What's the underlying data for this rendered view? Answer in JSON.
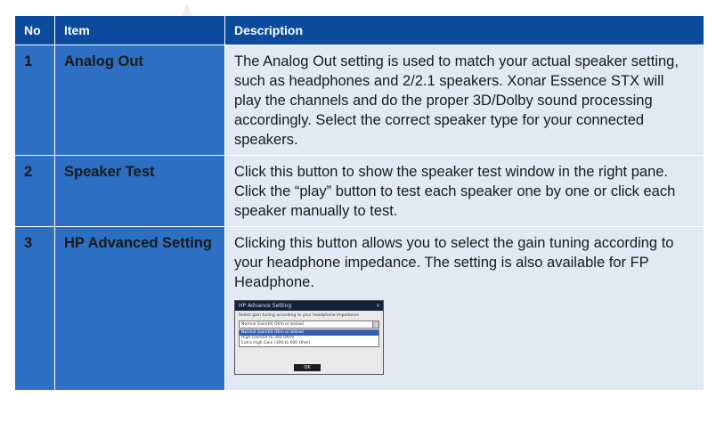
{
  "table": {
    "headers": {
      "no": "No",
      "item": "Item",
      "description": "Description"
    },
    "rows": [
      {
        "no": "1",
        "item": "Analog Out",
        "description": "The Analog Out setting is used to match your actual speaker setting, such as headphones and 2/2.1 speakers. Xonar Essence STX will play the channels and do the proper 3D/Dolby sound processing accordingly. Select the correct speaker type for your connected speakers."
      },
      {
        "no": "2",
        "item": "Speaker Test",
        "description": "Click this button to show the speaker test window in the right pane. Click the “play” button to test each speaker one by one or click each speaker manually to test."
      },
      {
        "no": "3",
        "item": "HP Advanced Setting",
        "description": "Clicking this button allows you to select the gain tuning according to your headphone impedance. The setting is also available for FP Headphone."
      }
    ]
  },
  "dialog_thumbnail": {
    "title": "HP Advance Setting",
    "close_glyph": "×",
    "instruction": "Select gain tuning according to your headphone impedance",
    "selected": "Normal Gain(64 Ohm or below)",
    "options": [
      "Normal Gain(64 Ohm or below)",
      "High Gain(64 to 300 Ohm)",
      "Extra High Gain (300 to 600 Ohm)"
    ],
    "ok_label": "OK"
  },
  "colors": {
    "header_bg": "#0b4a9c",
    "label_bg": "#2d6fc2",
    "desc_bg": "#e1e9f5"
  }
}
